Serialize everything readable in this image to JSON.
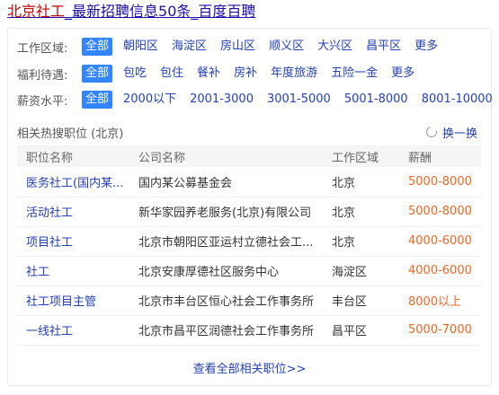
{
  "title": {
    "highlight": "北京社工",
    "rest": "_最新招聘信息50条_百度百聘"
  },
  "filters": [
    {
      "label": "工作区域:",
      "options": [
        "全部",
        "朝阳区",
        "海淀区",
        "房山区",
        "顺义区",
        "大兴区",
        "昌平区",
        "更多"
      ],
      "selected": 0
    },
    {
      "label": "福利待遇:",
      "options": [
        "全部",
        "包吃",
        "包住",
        "餐补",
        "房补",
        "年度旅游",
        "五险一金",
        "更多"
      ],
      "selected": 0
    },
    {
      "label": "薪资水平:",
      "options": [
        "全部",
        "2000以下",
        "2001-3000",
        "3001-5000",
        "5001-8000",
        "8001-10000"
      ],
      "selected": 0
    }
  ],
  "related": {
    "title": "相关热搜职位 (北京)",
    "refresh_label": "换一换"
  },
  "table": {
    "headers": [
      "职位名称",
      "公司名称",
      "工作区域",
      "薪酬"
    ],
    "rows": [
      {
        "job": "医务社工(国内某...",
        "company": "国内某公募基金会",
        "area": "北京",
        "salary": "5000-8000"
      },
      {
        "job": "活动社工",
        "company": "新华家园养老服务(北京)有限公司",
        "area": "北京",
        "salary": "5000-8000"
      },
      {
        "job": "项目社工",
        "company": "北京市朝阳区亚运村立德社会工...",
        "area": "北京",
        "salary": "4000-6000"
      },
      {
        "job": "社工",
        "company": "北京安康厚德社区服务中心",
        "area": "海淀区",
        "salary": "4000-6000"
      },
      {
        "job": "社工项目主管",
        "company": "北京市丰台区恒心社会工作事务所",
        "area": "丰台区",
        "salary": "8000以上"
      },
      {
        "job": "一线社工",
        "company": "北京市昌平区润德社会工作事务所",
        "area": "昌平区",
        "salary": "5000-7000"
      }
    ]
  },
  "more_link": "查看全部相关职位>>",
  "colors": {
    "link": "#2440b3",
    "title_highlight": "#cc0000",
    "active_bg": "#3385ff",
    "salary": "#f26522"
  }
}
